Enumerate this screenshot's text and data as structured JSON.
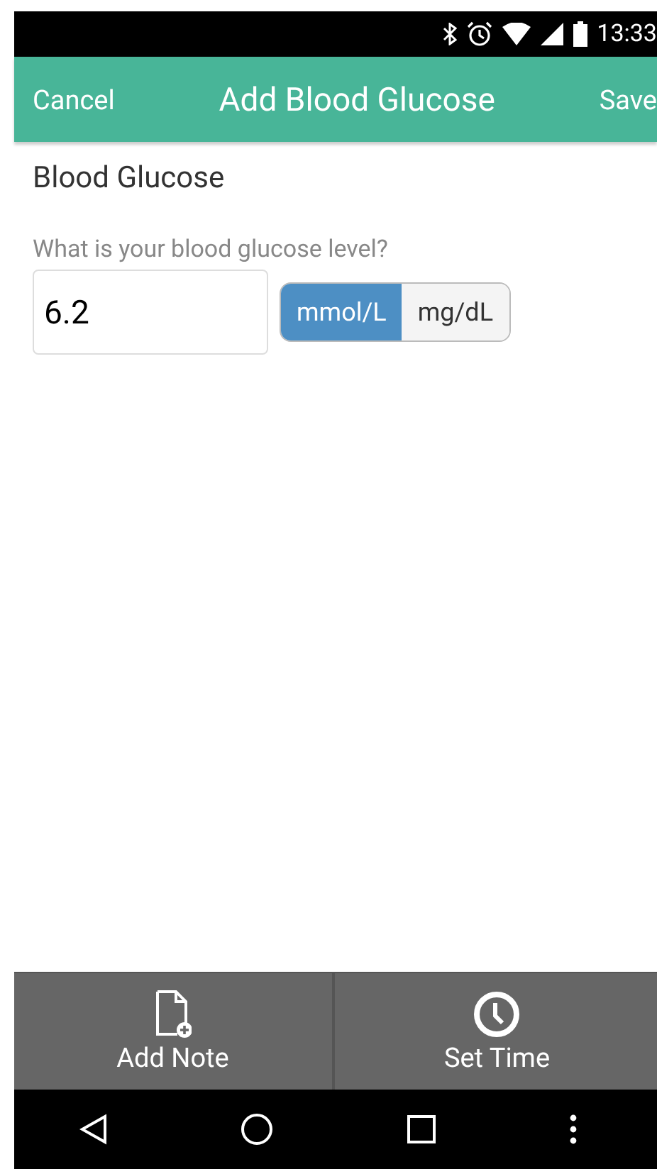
{
  "status_bar": {
    "time": "13:33"
  },
  "app_bar": {
    "cancel": "Cancel",
    "title": "Add Blood Glucose",
    "save": "Save"
  },
  "section_title": "Blood Glucose",
  "question": "What is your blood glucose level?",
  "value": "6.2",
  "units": [
    {
      "label": "mmol/L",
      "selected": true
    },
    {
      "label": "mg/dL",
      "selected": false
    }
  ],
  "actions": [
    {
      "kind": "note",
      "label": "Add Note"
    },
    {
      "kind": "time",
      "label": "Set Time"
    }
  ]
}
